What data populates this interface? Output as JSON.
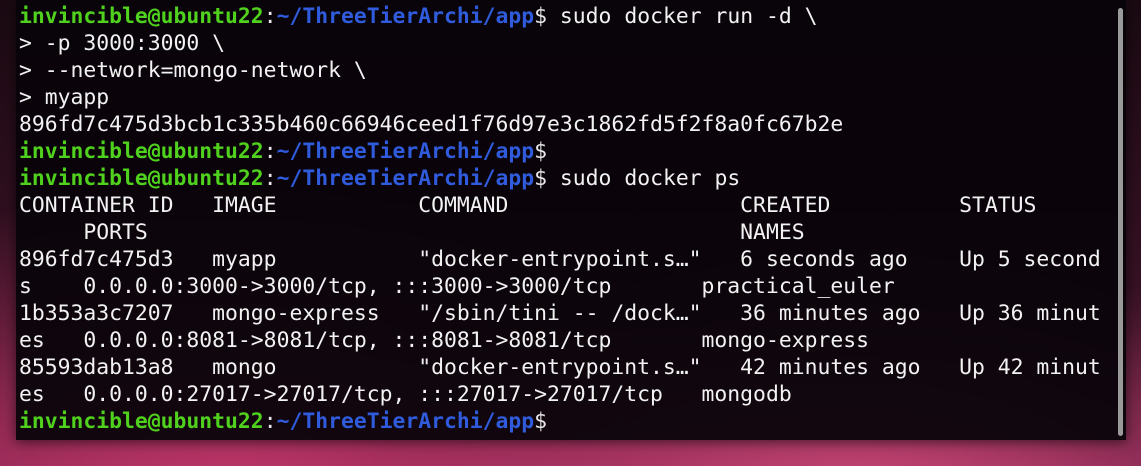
{
  "prompt": {
    "user_host": "invincible@ubuntu22",
    "sep": ":",
    "path": "~/ThreeTierArchi/app",
    "dollar": "$"
  },
  "lines": [
    {
      "kind": "prompt",
      "cmd": " sudo docker run -d \\"
    },
    {
      "kind": "text",
      "text": "> -p 3000:3000 \\"
    },
    {
      "kind": "text",
      "text": "> --network=mongo-network \\"
    },
    {
      "kind": "text",
      "text": "> myapp"
    },
    {
      "kind": "text",
      "text": "896fd7c475d3bcb1c335b460c66946ceed1f76d97e3c1862fd5f2f8a0fc67b2e"
    },
    {
      "kind": "prompt",
      "cmd": ""
    },
    {
      "kind": "prompt",
      "cmd": " sudo docker ps"
    },
    {
      "kind": "text",
      "text": "CONTAINER ID   IMAGE           COMMAND                  CREATED          STATUS"
    },
    {
      "kind": "text",
      "text": "     PORTS                                              NAMES"
    },
    {
      "kind": "text",
      "text": "896fd7c475d3   myapp           \"docker-entrypoint.s…\"   6 seconds ago    Up 5 second"
    },
    {
      "kind": "text",
      "text": "s    0.0.0.0:3000->3000/tcp, :::3000->3000/tcp       practical_euler"
    },
    {
      "kind": "text",
      "text": "1b353a3c7207   mongo-express   \"/sbin/tini -- /dock…\"   36 minutes ago   Up 36 minut"
    },
    {
      "kind": "text",
      "text": "es   0.0.0.0:8081->8081/tcp, :::8081->8081/tcp       mongo-express"
    },
    {
      "kind": "text",
      "text": "85593dab13a8   mongo           \"docker-entrypoint.s…\"   42 minutes ago   Up 42 minut"
    },
    {
      "kind": "text",
      "text": "es   0.0.0.0:27017->27017/tcp, :::27017->27017/tcp   mongodb"
    },
    {
      "kind": "prompt",
      "cmd": ""
    }
  ],
  "colors": {
    "user_host": "#4fd11d",
    "path": "#2f5bdc",
    "text": "#f2f2f2",
    "terminal_bg": "#08040a"
  }
}
